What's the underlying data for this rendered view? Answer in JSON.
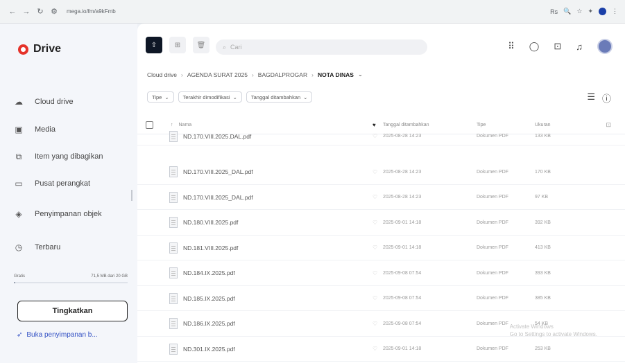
{
  "browser": {
    "url": "mega.io/fm/a9kFmb",
    "right_text": "Rs"
  },
  "app": {
    "logo": "Drive"
  },
  "sidebar": {
    "items": [
      {
        "label": "Cloud drive",
        "icon": "cloud-icon"
      },
      {
        "label": "Media",
        "icon": "media-icon"
      },
      {
        "label": "Item yang dibagikan",
        "icon": "shared-icon"
      },
      {
        "label": "Pusat perangkat",
        "icon": "devices-icon"
      },
      {
        "label": "Penyimpanan objek",
        "icon": "object-storage-icon"
      },
      {
        "label": "Terbaru",
        "icon": "clock-icon"
      }
    ],
    "storage_label": "Gratis",
    "storage_value": "71,5 MB dari 20 GB",
    "storage_fraction": 0.004,
    "upgrade_label": "Tingkatkan",
    "open_storage_label": "Buka penyimpanan b..."
  },
  "search": {
    "placeholder": "Cari"
  },
  "breadcrumb": {
    "items": [
      "Cloud drive",
      "AGENDA SURAT 2025",
      "BAGDALPROGAR"
    ],
    "current": "NOTA DINAS"
  },
  "filters": {
    "type": "Tipe",
    "modified": "Terakhir dimodifikasi",
    "added": "Tanggal ditambahkan"
  },
  "table": {
    "headers": {
      "name": "Nama",
      "date": "Tanggal ditambahkan",
      "type": "Tipe",
      "size": "Ukuran"
    },
    "rows": [
      {
        "name": "ND.170.VIII.2025.DAL.pdf",
        "date": "2025-08-28 14:23",
        "type": "Dokumen PDF",
        "size": "133 KB"
      },
      {
        "name": "ND.170.VIII.2025_DAL.pdf",
        "date": "2025-08-28 14:23",
        "type": "Dokumen PDF",
        "size": "170 KB"
      },
      {
        "name": "ND.170.VIII.2025_DAL.pdf",
        "date": "2025-08-28 14:23",
        "type": "Dokumen PDF",
        "size": "97 KB"
      },
      {
        "name": "ND.180.VIII.2025.pdf",
        "date": "2025-09-01 14:18",
        "type": "Dokumen PDF",
        "size": "392 KB"
      },
      {
        "name": "ND.181.VIII.2025.pdf",
        "date": "2025-09-01 14:18",
        "type": "Dokumen PDF",
        "size": "413 KB"
      },
      {
        "name": "ND.184.IX.2025.pdf",
        "date": "2025-09-08 07:54",
        "type": "Dokumen PDF",
        "size": "393 KB"
      },
      {
        "name": "ND.185.IX.2025.pdf",
        "date": "2025-09-08 07:54",
        "type": "Dokumen PDF",
        "size": "385 KB"
      },
      {
        "name": "ND.186.IX.2025.pdf",
        "date": "2025-09-08 07:54",
        "type": "Dokumen PDF",
        "size": "54 KB"
      },
      {
        "name": "ND.301.IX.2025.pdf",
        "date": "2025-09-01 14:18",
        "type": "Dokumen PDF",
        "size": "253 KB"
      }
    ]
  },
  "watermark": {
    "line1": "Activate Windows",
    "line2": "Go to Settings to activate Windows."
  }
}
